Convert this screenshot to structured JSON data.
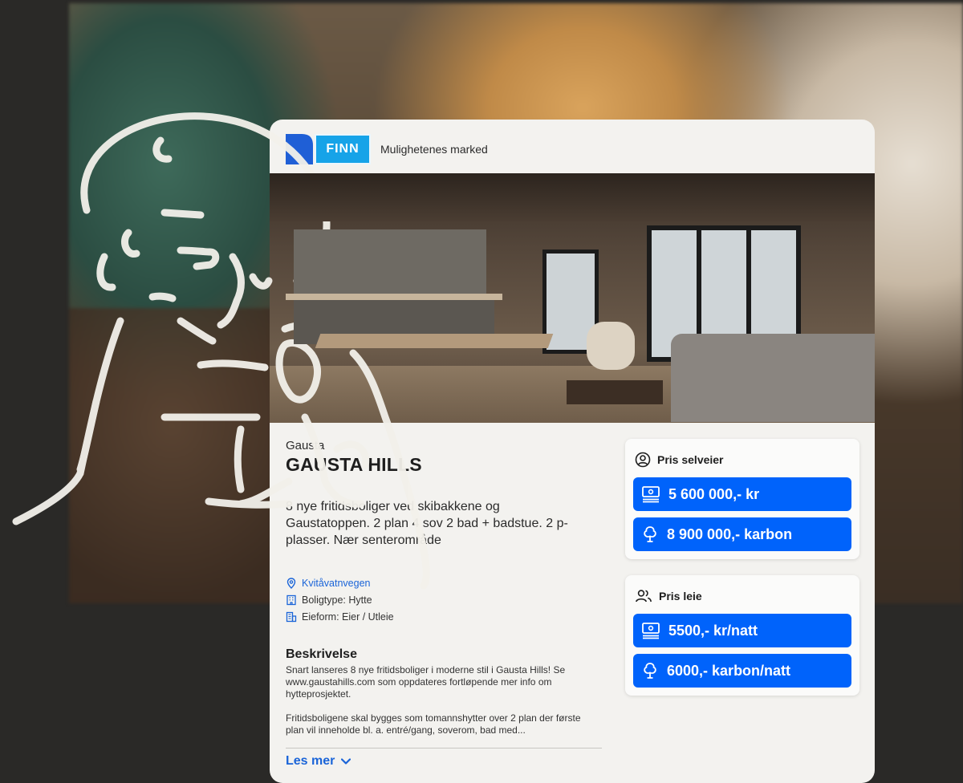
{
  "header": {
    "logo_text": "FINN",
    "tagline": "Mulighetenes marked"
  },
  "listing": {
    "location": "Gausta",
    "title": "GAUSTA HILLS",
    "summary": "8 nye fritidsboliger ved skibakkene og Gaustatoppen. 2 plan 4 sov 2 bad + badstue. 2 p-plasser. Nær senterområde",
    "address": "Kvitåvatnvegen",
    "property_type": "Boligtype: Hytte",
    "ownership": "Eieform: Eier / Utleie",
    "description_title": "Beskrivelse",
    "description_p1": "Snart lanseres 8 nye fritidsboliger i moderne stil i Gausta Hills! Se www.gaustahills.com som oppdateres fortløpende mer info om hytteprosjektet.",
    "description_p2": "Fritidsboligene skal bygges som tomannshytter over 2 plan der første plan vil inneholde bl. a. entré/gang, soverom, bad med...",
    "read_more": "Les mer"
  },
  "price_owner": {
    "heading": "Pris selveier",
    "money": "5 600 000,- kr",
    "carbon": "8 900 000,- karbon"
  },
  "price_rent": {
    "heading": "Pris leie",
    "money": "5500,- kr/natt",
    "carbon": "6000,- karbon/natt"
  },
  "colors": {
    "accent": "#0063fb",
    "link": "#1a64d8",
    "finn_blue": "#16a3e8",
    "card_bg": "#f3f2ef",
    "page_bg": "#2a2927"
  },
  "icons": [
    "location-pin-icon",
    "building-icon",
    "ownership-icon",
    "user-circle-icon",
    "users-icon",
    "banknote-icon",
    "tree-icon",
    "chevron-down-icon"
  ]
}
